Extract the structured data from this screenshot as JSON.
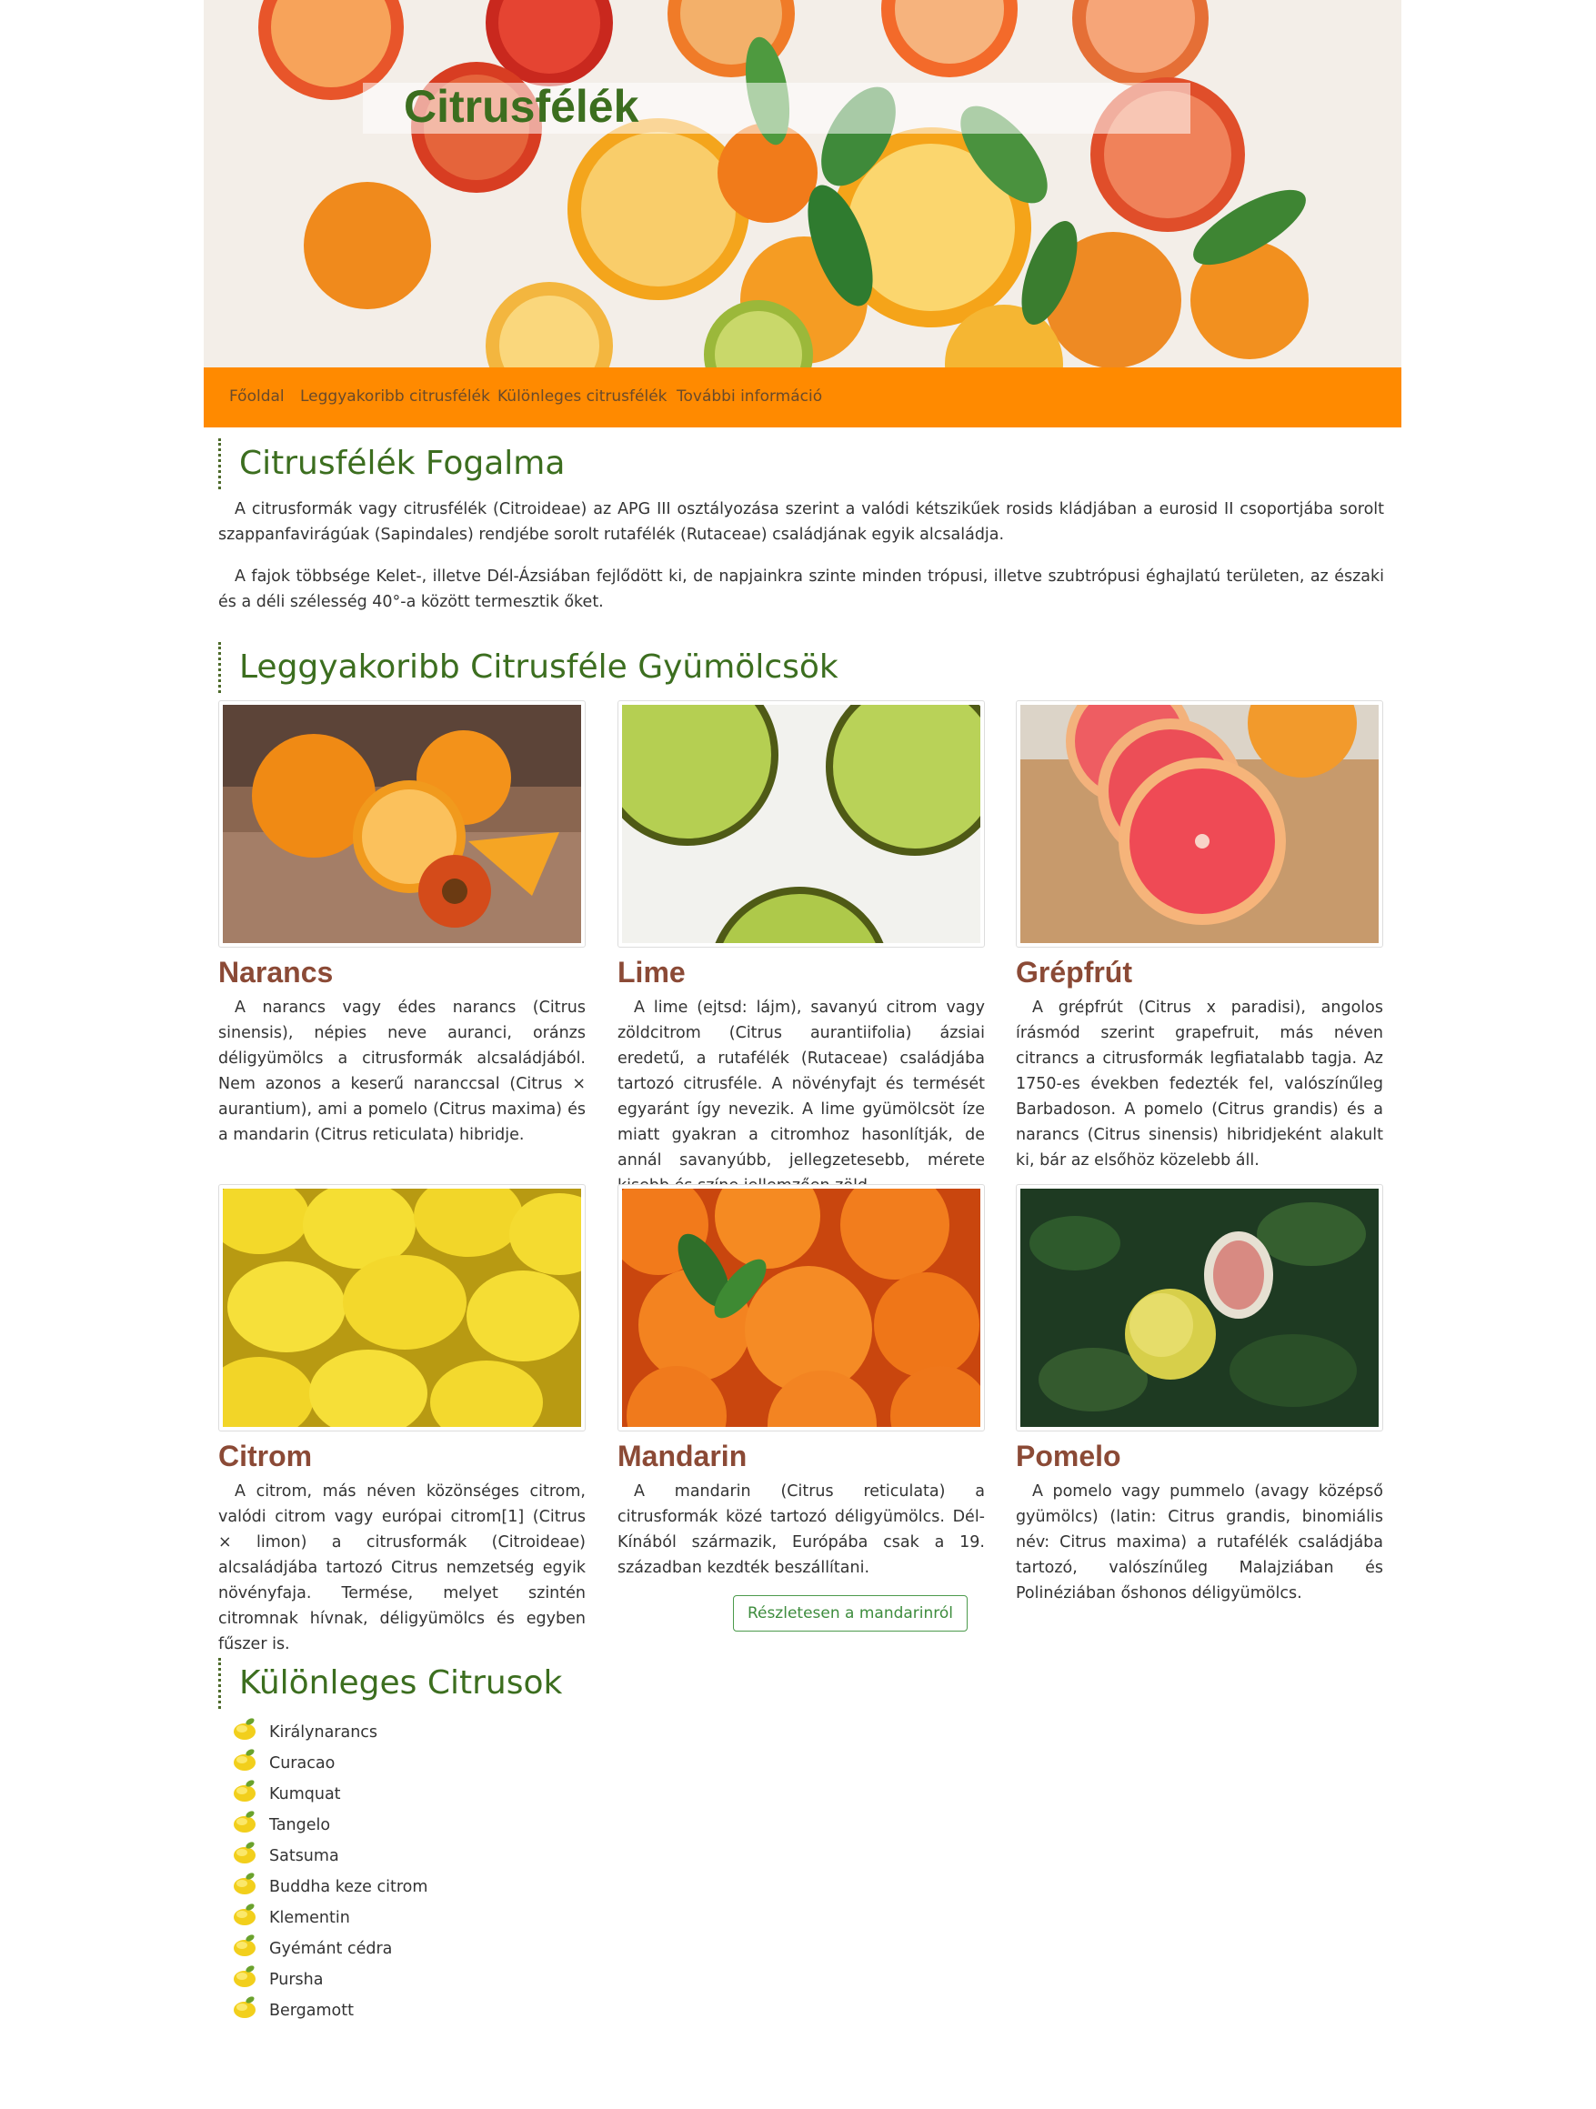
{
  "site": {
    "title": "Citrusfélék"
  },
  "nav": {
    "items": [
      "Főoldal",
      "Leggyakoribb citrusfélék",
      "Különleges citrusfélék",
      "További információ"
    ]
  },
  "intro": {
    "heading": "Citrusfélék Fogalma",
    "paragraphs": [
      "A citrusformák vagy citrusfélék (Citroideae) az APG III osztályozása szerint a valódi kétszikűek rosids kládjában a eurosid II csoportjába sorolt szappanfavirágúak (Sapindales) rendjébe sorolt rutafélék (Rutaceae) családjának egyik alcsaládja.",
      "A fajok többsége Kelet-, illetve Dél-Ázsiában fejlődött ki, de napjainkra szinte minden trópusi, illetve szubtrópusi éghajlatú területen, az északi és a déli szélesség 40°-a között termesztik őket."
    ]
  },
  "common": {
    "heading": "Leggyakoribb Citrusféle Gyümölcsök",
    "fruits": [
      {
        "name": "Narancs",
        "icon": "orange-photo",
        "text": "A narancs vagy édes narancs (Citrus sinensis), népies neve auranci, oránzs déligyümölcs a citrusformák alcsaládjából. Nem azonos a keserű naranccsal (Citrus × aurantium), ami a pomelo (Citrus maxima) és a mandarin (Citrus reticulata) hibridje."
      },
      {
        "name": "Lime",
        "icon": "lime-photo",
        "text": "A lime (ejtsd: lájm), savanyú citrom vagy zöldcitrom (Citrus aurantiifolia) ázsiai eredetű, a rutafélék (Rutaceae) családjába tartozó citrusféle. A növényfajt és termését egyaránt így nevezik. A lime gyümölcsöt íze miatt gyakran a citromhoz hasonlítják, de annál savanyúbb, jellegzetesebb, mérete kisebb és színe jellemzően zöld."
      },
      {
        "name": "Grépfrút",
        "icon": "grapefruit-photo",
        "text": "A grépfrút (Citrus x paradisi), angolos írásmód szerint grapefruit, más néven citrancs a citrusformák legfiatalabb tagja. Az 1750-es években fedezték fel, valószínűleg Barbadoson. A pomelo (Citrus grandis) és a narancs (Citrus sinensis) hibridjeként alakult ki, bár az elsőhöz közelebb áll."
      },
      {
        "name": "Citrom",
        "icon": "lemon-photo",
        "text": "A citrom, más néven közönséges citrom, valódi citrom vagy európai citrom[1] (Citrus × limon) a citrusformák (Citroideae) alcsaládjába tartozó Citrus nemzetség egyik növényfaja. Termése, melyet szintén citromnak hívnak, déligyümölcs és egyben fűszer is."
      },
      {
        "name": "Mandarin",
        "icon": "mandarin-photo",
        "text": "A mandarin (Citrus reticulata) a citrusformák közé tartozó déligyümölcs. Dél-Kínából származik, Európába csak a 19. században kezdték beszállítani."
      },
      {
        "name": "Pomelo",
        "icon": "pomelo-photo",
        "text": "A pomelo vagy pummelo (avagy középső gyümölcs) (latin: Citrus grandis, binomiális név: Citrus maxima) a rutafélék családjába tartozó, valószínűleg Malajziában és Polinéziában őshonos déligyümölcs."
      }
    ],
    "button_label": "Részletesen a mandarinról"
  },
  "special": {
    "heading": "Különleges Citrusok",
    "icon": "lemon-bullet-icon",
    "items": [
      "Királynarancs",
      "Curacao",
      "Kumquat",
      "Tangelo",
      "Satsuma",
      "Buddha keze citrom",
      "Klementin",
      "Gyémánt cédra",
      "Pursha",
      "Bergamott"
    ]
  },
  "colors": {
    "nav_bg": "#ff8a00",
    "heading": "#3c6e1f",
    "fruit_name": "#8b4a36",
    "button": "#3d8c3d"
  }
}
